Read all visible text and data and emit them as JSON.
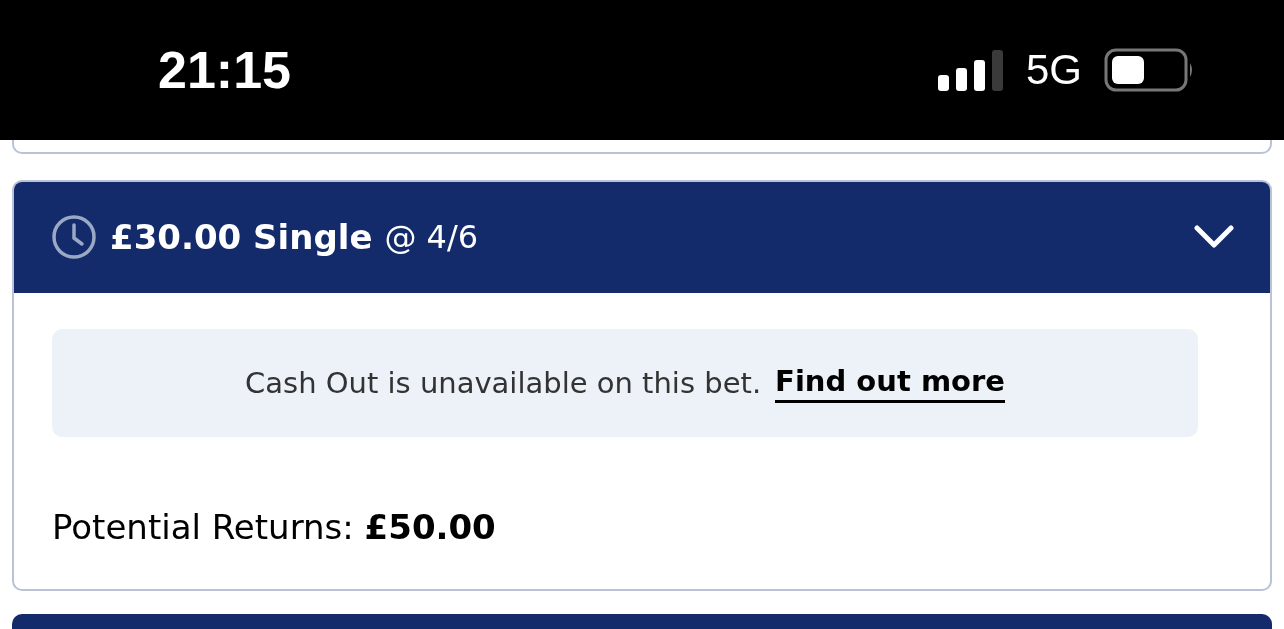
{
  "status_bar": {
    "time": "21:15",
    "network": "5G"
  },
  "bet": {
    "title": "£30.00 Single",
    "odds": "@ 4/6",
    "notice": {
      "text": "Cash Out is unavailable on this bet.",
      "link": "Find out more"
    },
    "returns": "Potential Returns: **£50.00**"
  }
}
